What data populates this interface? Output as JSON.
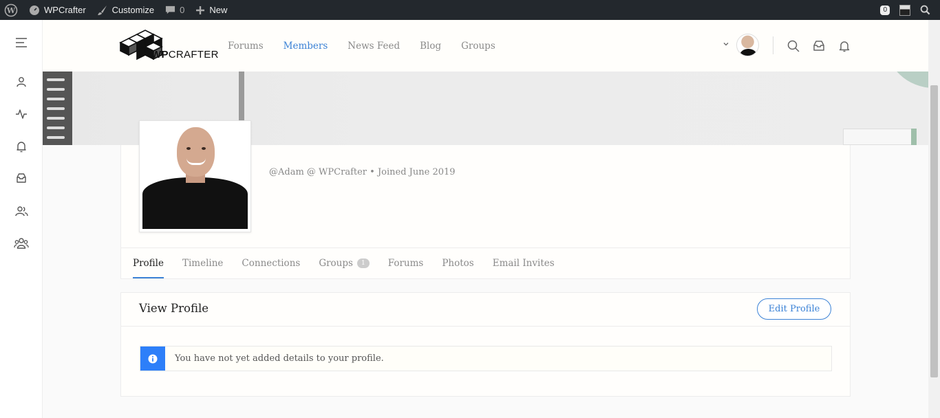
{
  "admin_bar": {
    "site_name": "WPCrafter",
    "customize": "Customize",
    "comments_count": "0",
    "new_label": "New",
    "notifications_count": "0"
  },
  "header": {
    "logo_text_bold": "WP",
    "logo_text_rest": "CRAFTER",
    "nav": [
      {
        "label": "Forums",
        "active": false
      },
      {
        "label": "Members",
        "active": true
      },
      {
        "label": "News Feed",
        "active": false
      },
      {
        "label": "Blog",
        "active": false
      },
      {
        "label": "Groups",
        "active": false
      }
    ]
  },
  "sidebar": {
    "icons": [
      "menu-icon",
      "user-icon",
      "activity-icon",
      "bell-icon",
      "inbox-icon",
      "users-icon",
      "groups-icon"
    ]
  },
  "profile": {
    "meta": "@Adam @ WPCrafter • Joined June 2019",
    "tabs": [
      {
        "label": "Profile",
        "active": true
      },
      {
        "label": "Timeline"
      },
      {
        "label": "Connections"
      },
      {
        "label": "Groups",
        "count": "1"
      },
      {
        "label": "Forums"
      },
      {
        "label": "Photos"
      },
      {
        "label": "Email Invites"
      }
    ]
  },
  "panel": {
    "title": "View Profile",
    "edit_label": "Edit Profile",
    "notice": "You have not yet added details to your profile."
  },
  "colors": {
    "accent": "#3b82d6",
    "admin_bar": "#23282d",
    "notice_icon": "#2d7ff9"
  }
}
